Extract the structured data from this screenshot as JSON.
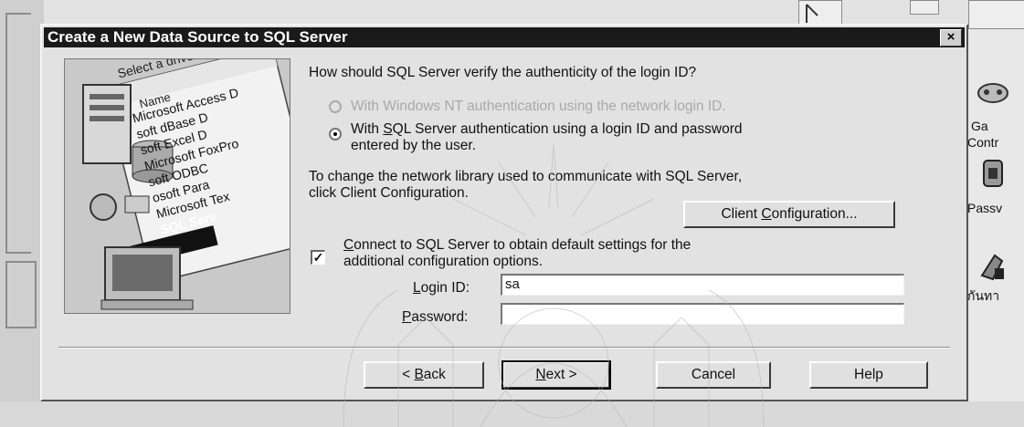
{
  "dialog": {
    "title": "Create a New Data Source to SQL Server",
    "close_label": "×",
    "question": "How should SQL Server verify the authenticity of the login ID?",
    "radio_nt_label": "With Windows NT authentication using the network login ID.",
    "radio_sql_line1_pre": "With ",
    "radio_sql_line1_ul": "S",
    "radio_sql_line1_post": "QL Server authentication using a login ID and password",
    "radio_sql_line2": "entered by the user.",
    "network_line1": "To change the network library used to communicate with SQL Server,",
    "network_line2": "click Client Configuration.",
    "client_config_pre": "Client ",
    "client_config_ul": "C",
    "client_config_post": "onfiguration...",
    "connect_check_mark": "✓",
    "connect_line1_ul": "C",
    "connect_line1_post": "onnect to SQL Server to obtain default settings for the",
    "connect_line2": "additional configuration options.",
    "login_label_ul": "L",
    "login_label_post": "ogin ID:",
    "login_value": "sa",
    "password_label_ul": "P",
    "password_label_post": "assword:",
    "password_value": "",
    "buttons": {
      "back_pre": "< ",
      "back_ul": "B",
      "back_post": "ack",
      "next_ul": "N",
      "next_post": "ext >",
      "cancel": "Cancel",
      "help": "Help"
    },
    "picture": {
      "header": "Select a driver for",
      "column": "Name",
      "drivers": [
        "Microsoft Access D",
        "soft dBase D",
        "soft Excel D",
        "Microsoft FoxPro",
        "soft ODBC",
        "osoft Para",
        "Microsoft Tex",
        "SQL Serv"
      ]
    }
  },
  "background": {
    "control_panel_label_1": "Ga",
    "control_panel_label_2": "Contr",
    "passwords_label": "Passv",
    "thai_label": "กันทา"
  }
}
